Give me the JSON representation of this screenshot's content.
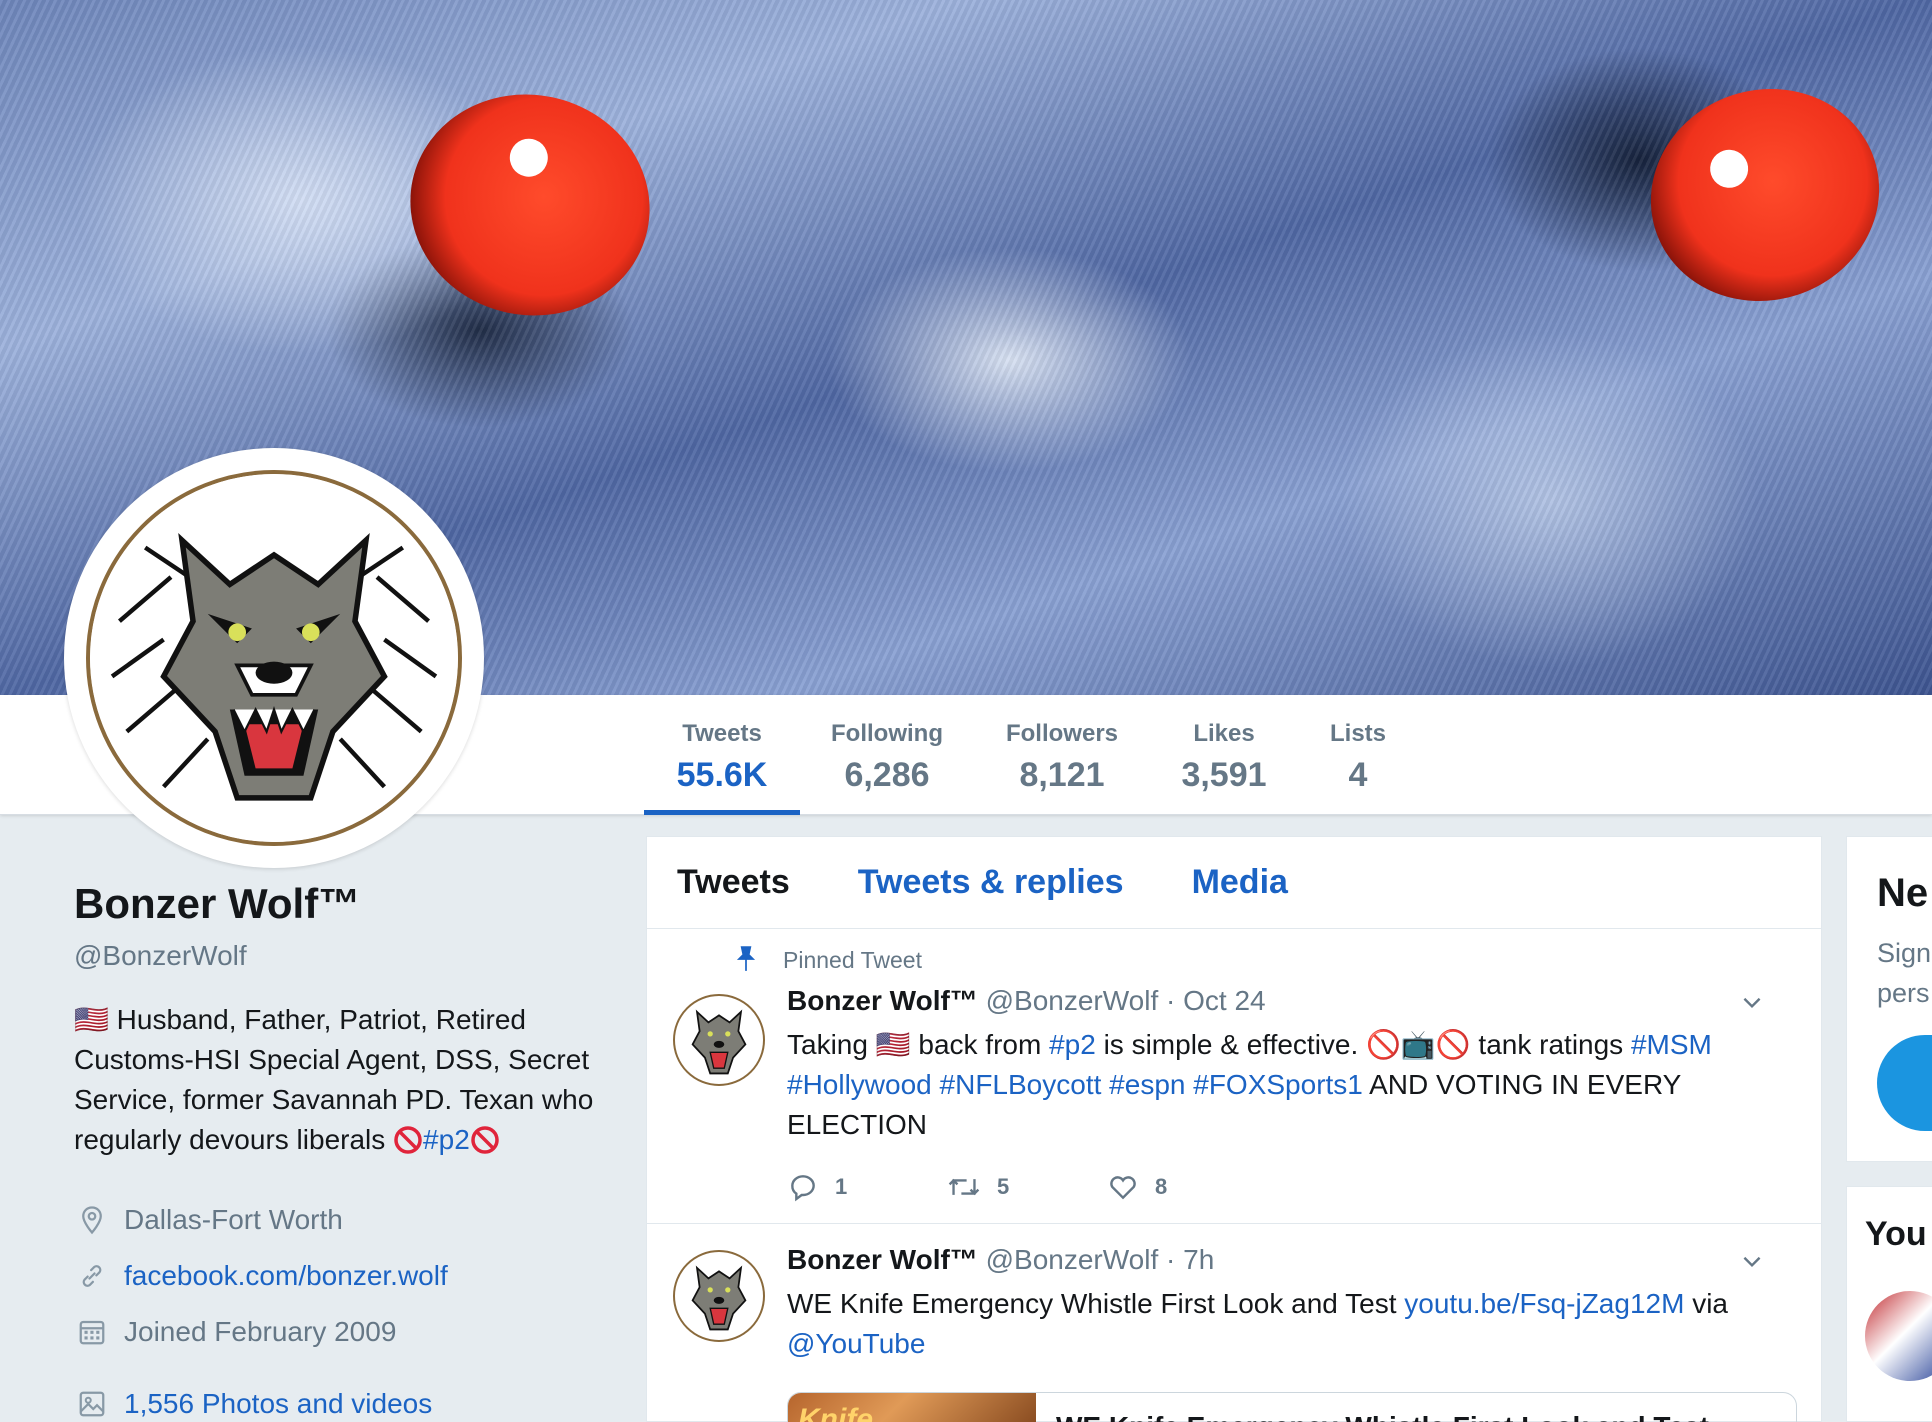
{
  "profile": {
    "name": "Bonzer Wolf™",
    "handle": "@BonzerWolf",
    "bio_flag": "🇺🇸",
    "bio": "Husband, Father, Patriot, Retired Customs-HSI Special Agent, DSS, Secret Service, former Savannah PD. Texan who regularly devours liberals",
    "bio_hashtag": "#p2",
    "location": "Dallas-Fort Worth",
    "website": "facebook.com/bonzer.wolf",
    "joined": "Joined February 2009",
    "photos": "1,556 Photos and videos"
  },
  "stats": [
    {
      "label": "Tweets",
      "value": "55.6K"
    },
    {
      "label": "Following",
      "value": "6,286"
    },
    {
      "label": "Followers",
      "value": "8,121"
    },
    {
      "label": "Likes",
      "value": "3,591"
    },
    {
      "label": "Lists",
      "value": "4"
    }
  ],
  "tabs": [
    "Tweets",
    "Tweets & replies",
    "Media"
  ],
  "tweets": [
    {
      "pinned_label": "Pinned Tweet",
      "name": "Bonzer Wolf™",
      "handle": "@BonzerWolf",
      "time": "· Oct 24",
      "text": {
        "p1": "Taking ",
        "flag": "🇺🇸",
        "p2": " back from ",
        "tag1": "#p2",
        "p3": " is simple & effective. ",
        "emoji": "🚫📺🚫",
        "p4": " tank ratings ",
        "tag2": "#MSM",
        "tag3": "#Hollywood",
        "tag4": "#NFLBoycott",
        "tag5": "#espn",
        "tag6": "#FOXSports1",
        "p5": " AND VOTING IN EVERY ELECTION"
      },
      "replies": "1",
      "retweets": "5",
      "likes": "8"
    },
    {
      "name": "Bonzer Wolf™",
      "handle": "@BonzerWolf",
      "time": "· 7h",
      "text": {
        "p1": "WE Knife Emergency Whistle First Look and Test ",
        "link": "youtu.be/Fsq-jZag12M",
        "p2": " via ",
        "mention": "@YouTube"
      },
      "card_thumb_text": "Knife",
      "card_title": "WE Knife Emergency Whistle First Look and Test"
    }
  ],
  "sidebar": {
    "card1_heading": "Ne",
    "card1_text_line1": "Sign",
    "card1_text_line2": "pers",
    "card2_heading": "You"
  },
  "colors": {
    "accent": "#1b63c4",
    "muted": "#657786",
    "background": "#e6ecf0"
  }
}
